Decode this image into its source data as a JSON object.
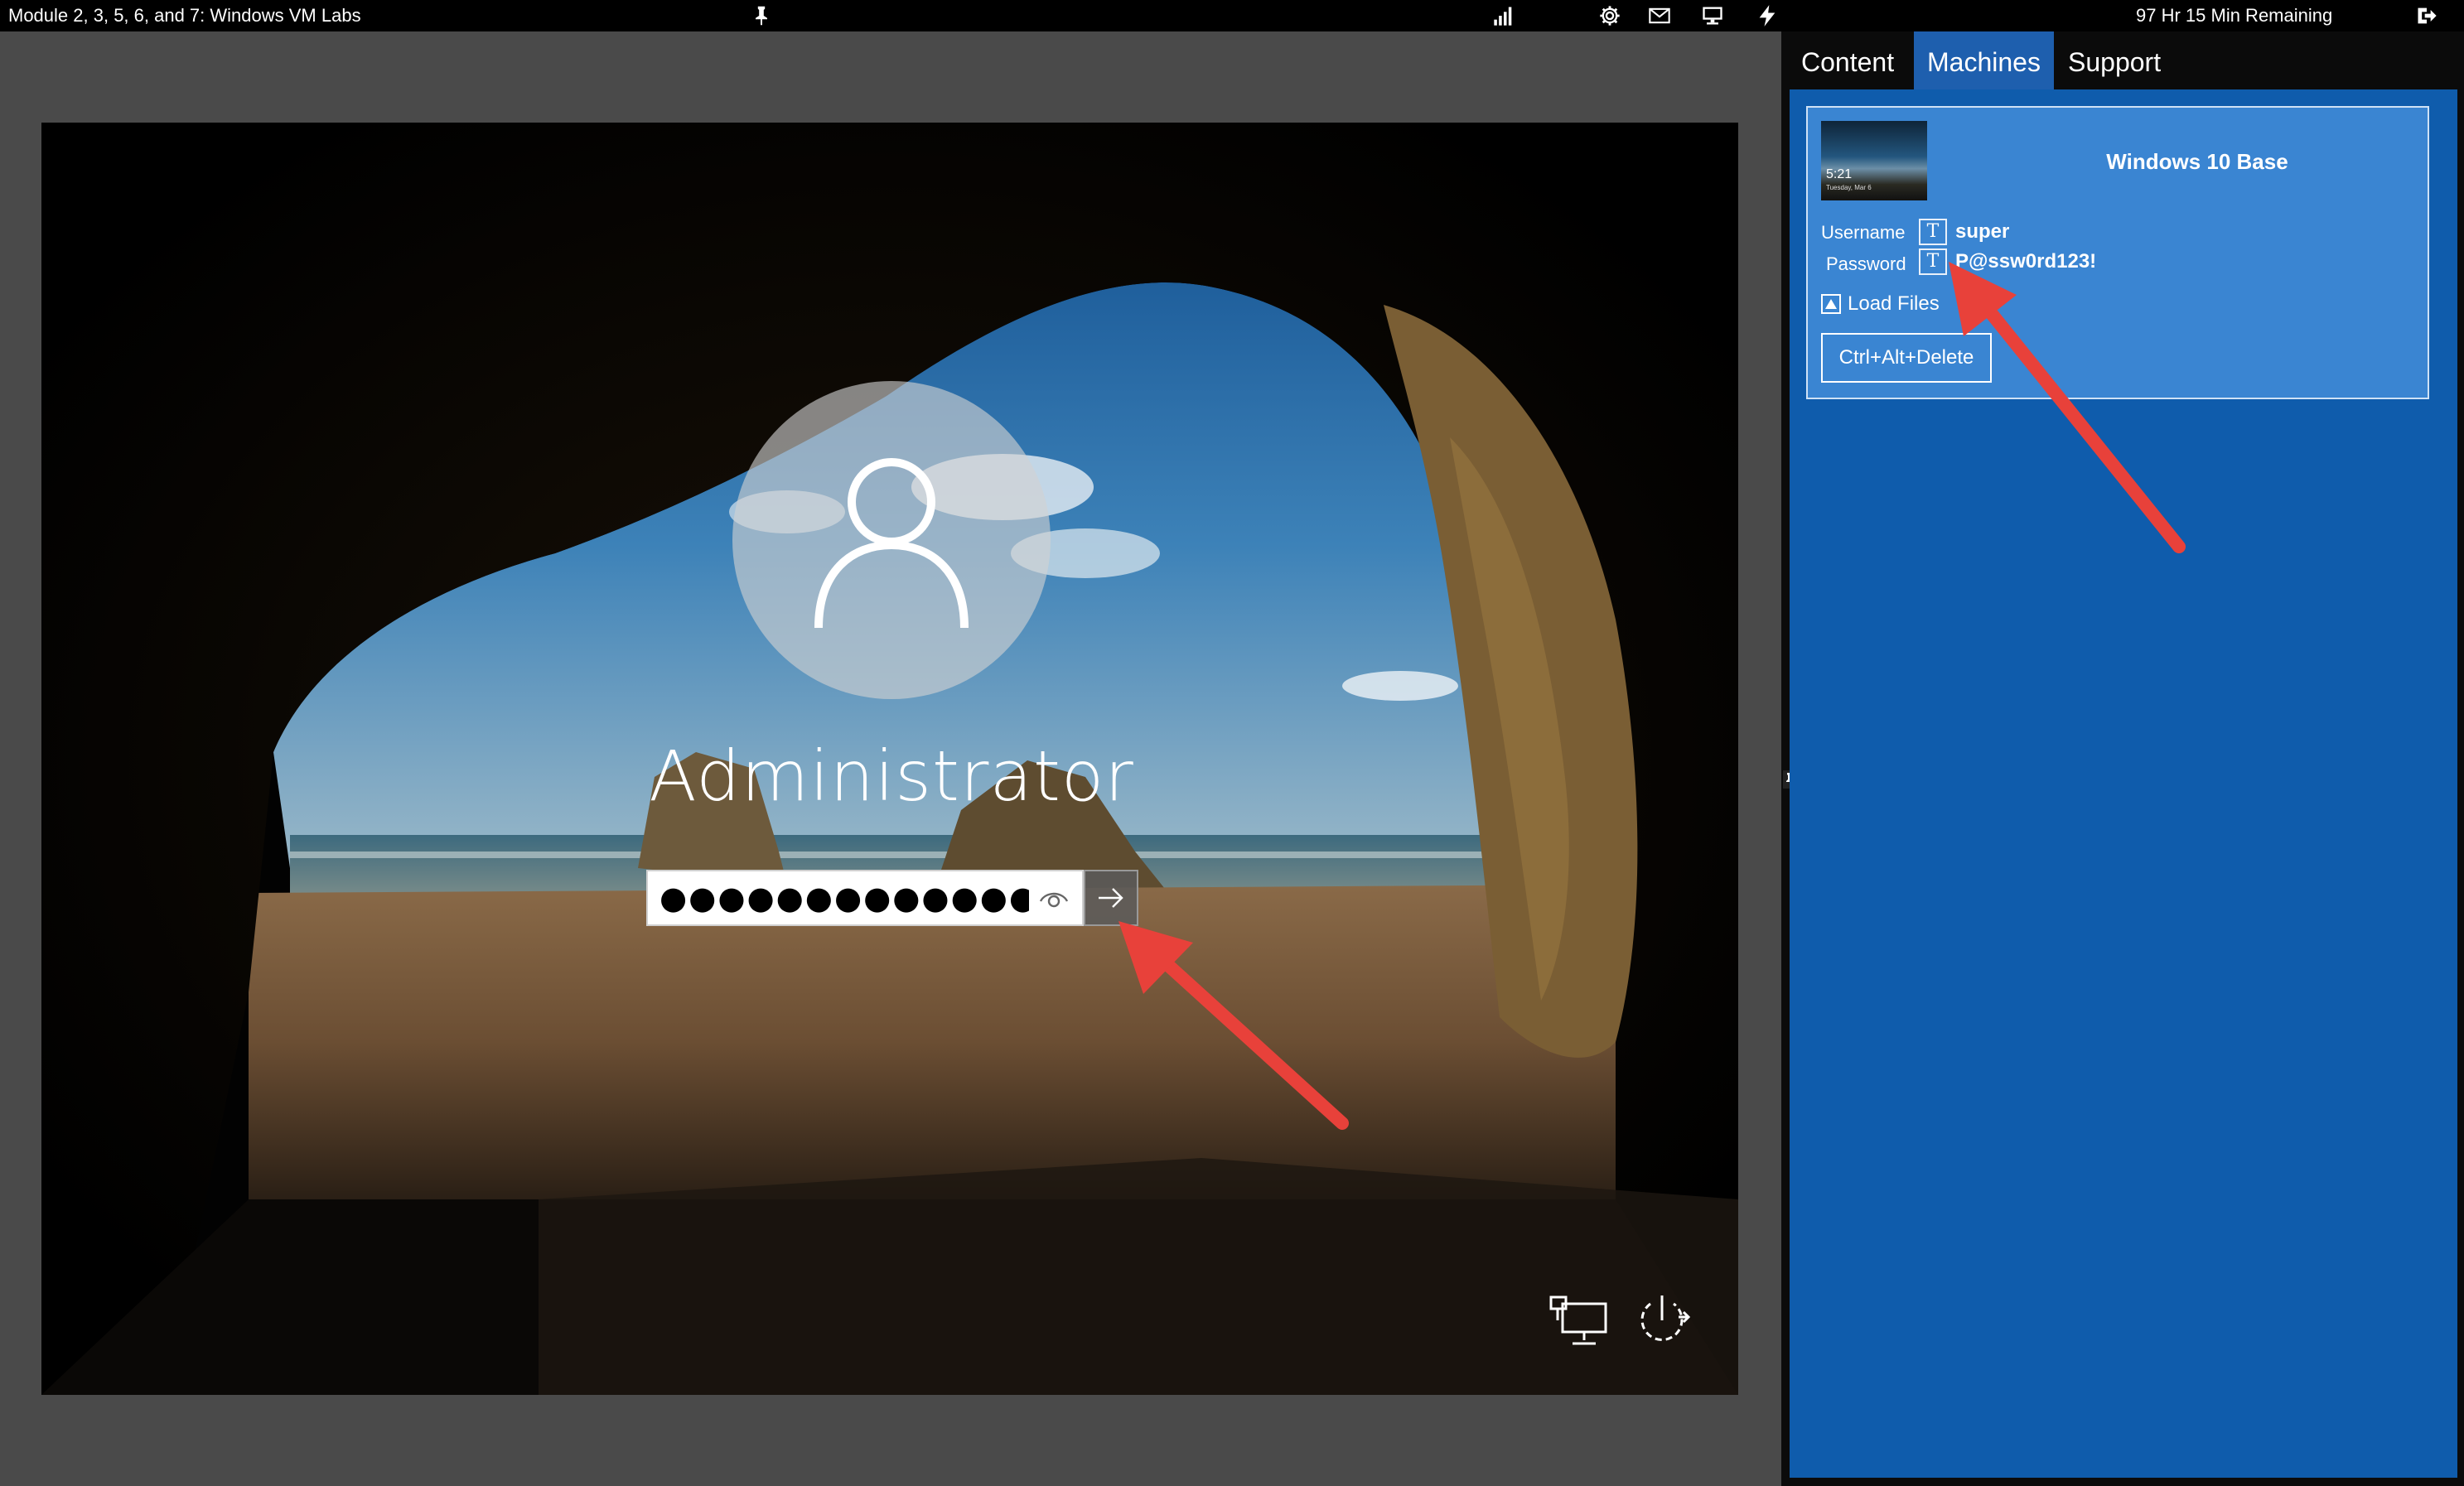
{
  "topbar": {
    "lab_title": "Module 2, 3, 5, 6, and 7: Windows VM Labs",
    "time_remaining": "97 Hr 15 Min Remaining",
    "icons": [
      "pin-icon",
      "signal-icon",
      "gear-icon",
      "mail-icon",
      "monitor-icon",
      "lightning-icon",
      "exit-icon"
    ]
  },
  "vm": {
    "user_name": "Administrator",
    "password_value": "●●●●●●●●●●●●●",
    "bottom_icons": [
      "network-icon",
      "power-icon"
    ]
  },
  "panel": {
    "tabs": [
      {
        "label": "Content",
        "active": false
      },
      {
        "label": "Machines",
        "active": true
      },
      {
        "label": "Support",
        "active": false
      }
    ],
    "machine": {
      "name": "Windows 10 Base",
      "thumb_time": "5:21",
      "thumb_date": "Tuesday, Mar 6",
      "username_label": "Username",
      "username_value": "super",
      "password_label": "Password",
      "password_value": "P@ssw0rd123!",
      "type_button_label": "T",
      "load_files_label": "Load Files",
      "cad_button_label": "Ctrl+Alt+Delete"
    }
  },
  "colors": {
    "panel_blue": "#0f5cac",
    "card_blue": "#3a85d2",
    "tab_active": "#1e5fae",
    "arrow_red": "#e8413a"
  }
}
